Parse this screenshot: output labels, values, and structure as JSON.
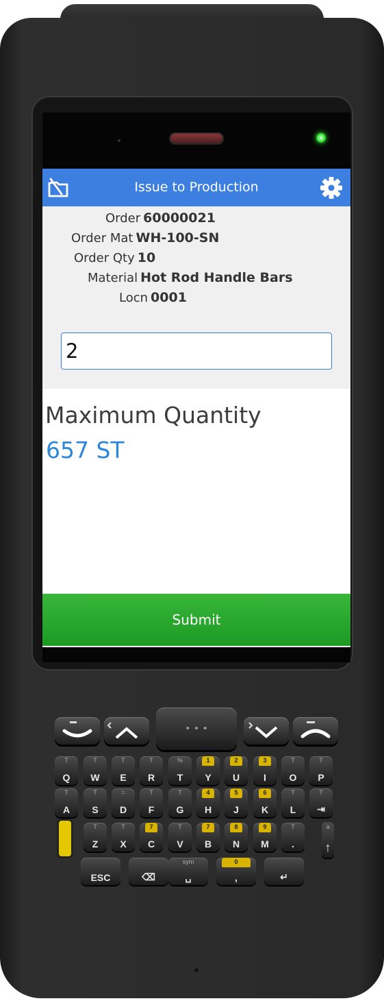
{
  "header": {
    "title": "Issue to Production",
    "back_icon": "back-box-icon",
    "settings_icon": "gear-icon"
  },
  "details": [
    {
      "label": "Order",
      "value": "60000021"
    },
    {
      "label": "Order Mat",
      "value": "WH-100-SN"
    },
    {
      "label": "Order Qty",
      "value": "10"
    },
    {
      "label": "Material",
      "value": "Hot Rod Handle Bars"
    },
    {
      "label": "Locn",
      "value": "0001"
    }
  ],
  "quantity_input": {
    "value": "2"
  },
  "max_quantity": {
    "label": "Maximum Quantity",
    "value": "657 ST"
  },
  "submit": {
    "label": "Submit"
  },
  "keyboard": {
    "row1": [
      {
        "main": "Q",
        "alt": "T"
      },
      {
        "main": "W",
        "alt": "T"
      },
      {
        "main": "E",
        "alt": "T"
      },
      {
        "main": "R",
        "alt": "T"
      },
      {
        "main": "T",
        "alt": "%"
      },
      {
        "main": "Y",
        "alt": "1"
      },
      {
        "main": "U",
        "alt": "2"
      },
      {
        "main": "I",
        "alt": "3"
      },
      {
        "main": "O",
        "alt": "T"
      },
      {
        "main": "P",
        "alt": "T"
      }
    ],
    "row2": [
      {
        "main": "A",
        "alt": "T"
      },
      {
        "main": "S",
        "alt": "T"
      },
      {
        "main": "D",
        "alt": "="
      },
      {
        "main": "F",
        "alt": "T"
      },
      {
        "main": "G",
        "alt": "T"
      },
      {
        "main": "H",
        "alt": "4"
      },
      {
        "main": "J",
        "alt": "5"
      },
      {
        "main": "K",
        "alt": "6"
      },
      {
        "main": "L",
        "alt": "T"
      },
      {
        "main": "⇥",
        "alt": "T"
      }
    ],
    "row3": [
      {
        "main": "Z",
        "alt": "T"
      },
      {
        "main": "X",
        "alt": "T"
      },
      {
        "main": "C",
        "alt": "7"
      },
      {
        "main": "V",
        "alt": "T"
      },
      {
        "main": "B",
        "alt": "7"
      },
      {
        "main": "N",
        "alt": "8"
      },
      {
        "main": "M",
        "alt": "9"
      },
      {
        "main": ".",
        "alt": "T"
      }
    ],
    "row4": [
      {
        "main": "ESC",
        "alt": ""
      },
      {
        "main": "⌫",
        "alt": ""
      },
      {
        "main": "␣",
        "alt": "sym"
      },
      {
        "main": ",",
        "alt": "0"
      },
      {
        "main": "↵",
        "alt": ""
      }
    ],
    "shift_key": {
      "main": "↑",
      "alt": "a"
    },
    "nav": {
      "center": "• • •"
    }
  }
}
